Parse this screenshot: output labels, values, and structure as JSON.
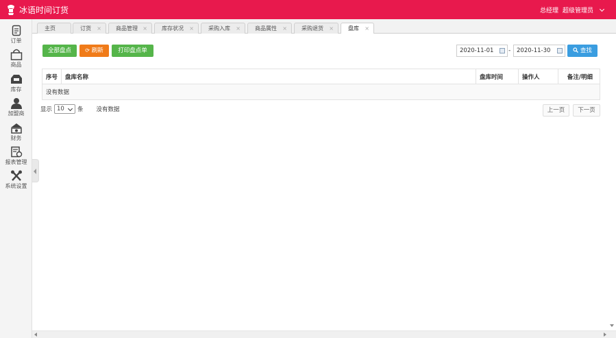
{
  "app": {
    "title": "冰语时间订货"
  },
  "user": {
    "role": "总经理",
    "name": "超级管理员"
  },
  "sidebar": {
    "items": [
      {
        "label": "订单",
        "icon": "order-icon"
      },
      {
        "label": "商品",
        "icon": "bag-icon"
      },
      {
        "label": "库存",
        "icon": "inventory-icon"
      },
      {
        "label": "加盟商",
        "icon": "user-icon"
      },
      {
        "label": "财务",
        "icon": "finance-icon"
      },
      {
        "label": "报表管理",
        "icon": "report-icon"
      },
      {
        "label": "系统设置",
        "icon": "tools-icon"
      }
    ]
  },
  "tabs": [
    {
      "label": "主页",
      "closable": false
    },
    {
      "label": "订货",
      "closable": true
    },
    {
      "label": "商品管理",
      "closable": true
    },
    {
      "label": "库存状况",
      "closable": true
    },
    {
      "label": "采购入库",
      "closable": true
    },
    {
      "label": "商品属性",
      "closable": true
    },
    {
      "label": "采购退货",
      "closable": true
    },
    {
      "label": "盘库",
      "closable": true,
      "active": true
    }
  ],
  "toolbar": {
    "all_check": "全部盘点",
    "refresh": "刷新",
    "print": "打印盘点单",
    "date_from": "2020-11-01",
    "date_sep": "-",
    "date_to": "2020-11-30",
    "search": "查找"
  },
  "table": {
    "columns": [
      "序号",
      "盘库名称",
      "盘库时间",
      "操作人",
      "备注/明细"
    ],
    "empty_text": "没有数据"
  },
  "pager": {
    "show_label": "显示",
    "page_size": "10",
    "unit": "条",
    "info": "没有数据",
    "prev": "上一页",
    "next": "下一页"
  },
  "colors": {
    "topbar": "#e8194d",
    "green": "#55b54a",
    "orange": "#f07b19",
    "blue": "#3a9de0"
  }
}
